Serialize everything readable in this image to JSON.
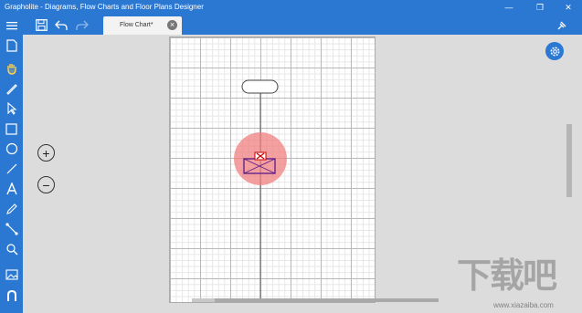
{
  "titlebar": {
    "title": "Grapholite - Diagrams, Flow Charts and Floor Plans Designer",
    "min": "—",
    "max": "❐",
    "close": "✕"
  },
  "toolbar": {
    "tab_label": "Flow Chart*",
    "tab_close": "×"
  },
  "zoom": {
    "in": "+",
    "out": "−"
  },
  "watermark": {
    "text": "下载吧",
    "url": "www.xiazaiba.com"
  },
  "colors": {
    "accent": "#2b78d3",
    "highlight": "#f08080",
    "selection": "#6a1b9a"
  }
}
